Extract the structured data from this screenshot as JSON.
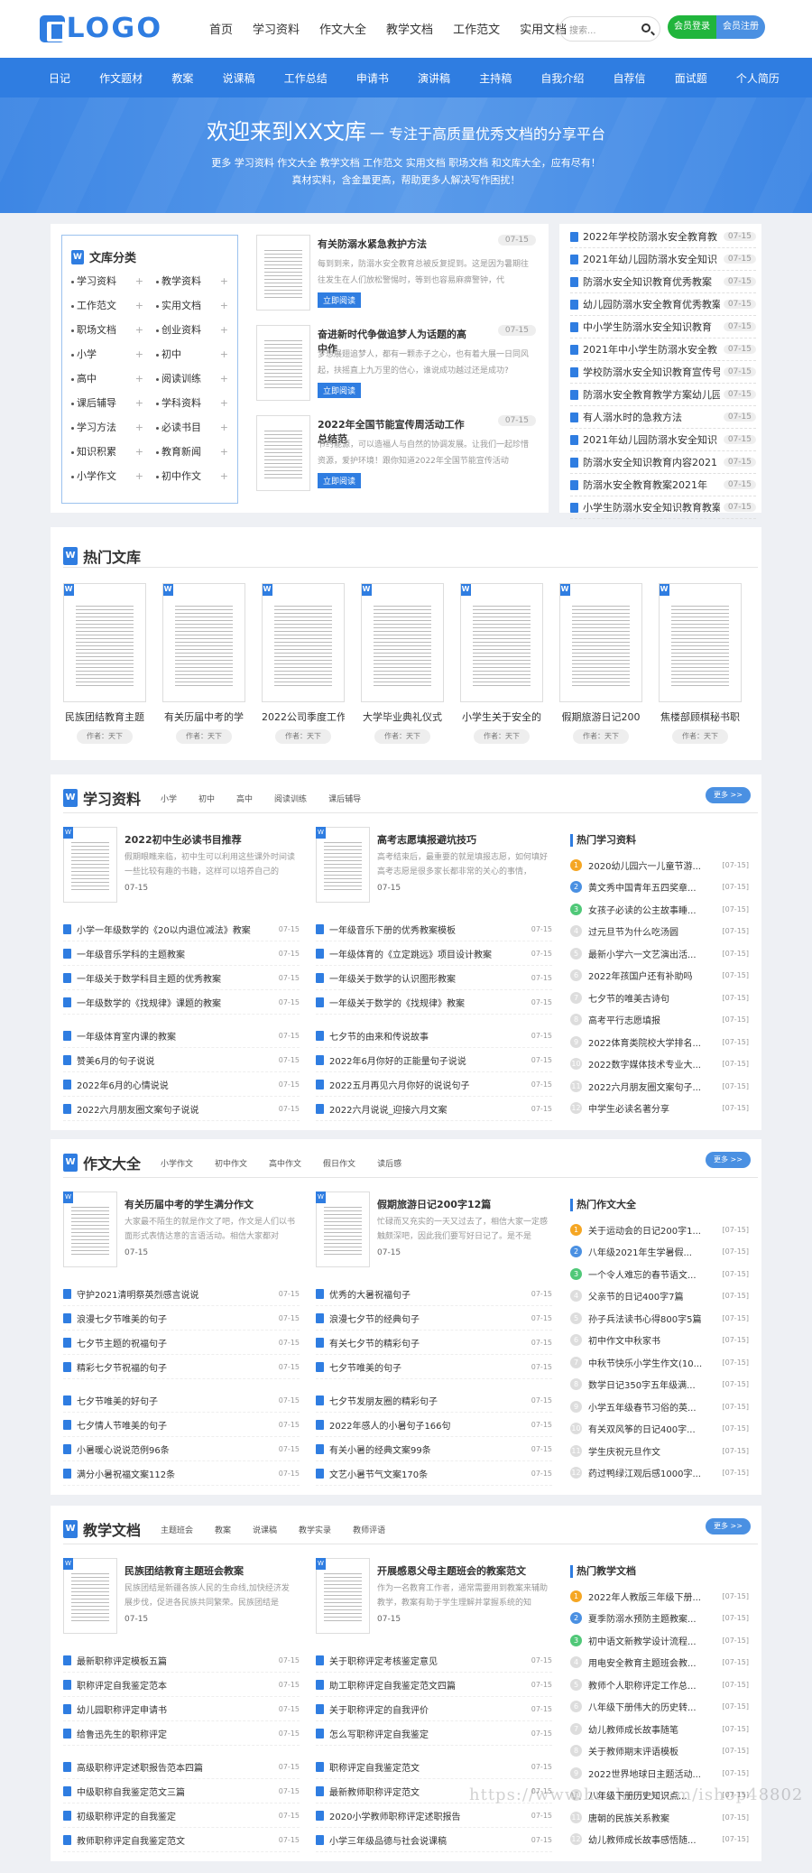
{
  "header": {
    "logo_text": "LOGO",
    "nav": [
      "首页",
      "学习资料",
      "作文大全",
      "教学文档",
      "工作范文",
      "实用文档"
    ],
    "search_placeholder": "搜索...",
    "login": "会员登录",
    "register": "会员注册"
  },
  "catbar": [
    "日记",
    "作文题材",
    "教案",
    "说课稿",
    "工作总结",
    "申请书",
    "演讲稿",
    "主持稿",
    "自我介绍",
    "自荐信",
    "面试题",
    "个人简历"
  ],
  "banner": {
    "title": "欢迎来到XX文库",
    "subtitle": "一 专注于高质量优秀文档的分享平台",
    "line1": "更多 学习资料 作文大全 教学文档 工作范文 实用文档 职场文档 和文库大全，应有尽有！",
    "line2": "真材实料，含金量更高，帮助更多人解决写作困扰！"
  },
  "categories": {
    "title": "文库分类",
    "items": [
      "学习资料",
      "教学资料",
      "工作范文",
      "实用文档",
      "职场文档",
      "创业资料",
      "小学",
      "初中",
      "高中",
      "阅读训练",
      "课后辅导",
      "学科资料",
      "学习方法",
      "必读书目",
      "知识积累",
      "教育新闻",
      "小学作文",
      "初中作文"
    ]
  },
  "featured": [
    {
      "title": "有关防溺水紧急救护方法",
      "date": "07-15",
      "desc": "每到到来，防溺水安全教育总被反复提到。这是因为暑期往往发生在人们放松警惕时，等到也容易麻痹警钟，代",
      "button": "立即阅读"
    },
    {
      "title": "奋进新时代争做追梦人为话题的高中作",
      "date": "07-15",
      "desc": "梦想展翅追梦人，都有一颗赤子之心，也有着大展一日同风起，扶摇直上九万里的信心，谁说成功越过还是成功?",
      "button": "立即阅读"
    },
    {
      "title": "2022年全国节能宣传周活动工作总结范",
      "date": "07-15",
      "desc": "节约能源，可以造福人与自然的协调发展。让我们一起珍惜资源，爱护环境！跟你知道2022年全国节能宣传活动",
      "button": "立即阅读"
    }
  ],
  "right_list": [
    {
      "title": "2022年学校防溺水安全教育教",
      "date": "07-15"
    },
    {
      "title": "2021年幼儿园防溺水安全知识",
      "date": "07-15"
    },
    {
      "title": "防溺水安全知识教育优秀教案",
      "date": "07-15"
    },
    {
      "title": "幼儿园防溺水安全教育优秀教案",
      "date": "07-15"
    },
    {
      "title": "中小学生防溺水安全知识教育",
      "date": "07-15"
    },
    {
      "title": "2021年中小学生防溺水安全教",
      "date": "07-15"
    },
    {
      "title": "学校防溺水安全知识教育宣传号",
      "date": "07-15"
    },
    {
      "title": "防溺水安全教育教学方案幼儿园",
      "date": "07-15"
    },
    {
      "title": "有人溺水时的急救方法",
      "date": "07-15"
    },
    {
      "title": "2021年幼儿园防溺水安全知识",
      "date": "07-15"
    },
    {
      "title": "防溺水安全知识教育内容2021",
      "date": "07-15"
    },
    {
      "title": "防溺水安全教育教案2021年",
      "date": "07-15"
    },
    {
      "title": "小学生防溺水安全知识教育教案",
      "date": "07-15"
    }
  ],
  "hot_library": {
    "title": "热门文库",
    "items": [
      {
        "title": "民族团结教育主题",
        "author": "作者：天下"
      },
      {
        "title": "有关历届中考的学",
        "author": "作者：天下"
      },
      {
        "title": "2022公司季度工作",
        "author": "作者：天下"
      },
      {
        "title": "大学毕业典礼仪式",
        "author": "作者：天下"
      },
      {
        "title": "小学生关于安全的",
        "author": "作者：天下"
      },
      {
        "title": "假期旅游日记200",
        "author": "作者：天下"
      },
      {
        "title": "焦楼部顾棋秘书职",
        "author": "作者：天下"
      }
    ]
  },
  "sections": [
    {
      "title": "学习资料",
      "tabs": [
        "小学",
        "初中",
        "高中",
        "阅读训练",
        "课后辅导"
      ],
      "more": "更多 >>",
      "leads": [
        {
          "title": "2022初中生必读书目推荐",
          "desc": "假期眼瞧来临，初中生可以利用这些课外时间读一些比较有趣的书籍，这样可以培养自己的",
          "date": "07-15"
        },
        {
          "title": "高考志愿填报避坑技巧",
          "desc": "高考结束后，最重要的就是填报志愿，如何填好高考志愿是很多家长都非常的关心的事情，",
          "date": "07-15"
        }
      ],
      "col1": [
        {
          "title": "小学一年级数学的《20以内退位减法》教案",
          "date": "07-15"
        },
        {
          "title": "一年级音乐学科的主题教案",
          "date": "07-15"
        },
        {
          "title": "一年级关于数学科目主题的优秀教案",
          "date": "07-15"
        },
        {
          "title": "一年级数学的《找规律》课题的教案",
          "date": "07-15"
        },
        {
          "title": "一年级体育室内课的教案",
          "date": "07-15"
        },
        {
          "title": "赞美6月的句子说说",
          "date": "07-15"
        },
        {
          "title": "2022年6月的心情说说",
          "date": "07-15"
        },
        {
          "title": "2022六月朋友圈文案句子说说",
          "date": "07-15"
        }
      ],
      "col2": [
        {
          "title": "一年级音乐下册的优秀教案模板",
          "date": "07-15"
        },
        {
          "title": "一年级体育的《立定跳远》项目设计教案",
          "date": "07-15"
        },
        {
          "title": "一年级关于数学的认识图形教案",
          "date": "07-15"
        },
        {
          "title": "一年级关于数学的《找规律》教案",
          "date": "07-15"
        },
        {
          "title": "七夕节的由来和传说故事",
          "date": "07-15"
        },
        {
          "title": "2022年6月你好的正能量句子说说",
          "date": "07-15"
        },
        {
          "title": "2022五月再见六月你好的说说句子",
          "date": "07-15"
        },
        {
          "title": "2022六月说说_迎接六月文案",
          "date": "07-15"
        }
      ],
      "hot_title": "热门学习资料",
      "hot": [
        {
          "title": "2020幼儿园六一儿童节游...",
          "date": "[07-15]"
        },
        {
          "title": "黄文秀中国青年五四奖章...",
          "date": "[07-15]"
        },
        {
          "title": "女孩子必读的公主故事睡...",
          "date": "[07-15]"
        },
        {
          "title": "过元旦节为什么吃汤圆",
          "date": "[07-15]"
        },
        {
          "title": "最新小学六一文艺演出活...",
          "date": "[07-15]"
        },
        {
          "title": "2022年孩国户还有补助吗",
          "date": "[07-15]"
        },
        {
          "title": "七夕节的唯美古诗句",
          "date": "[07-15]"
        },
        {
          "title": "高考平行志愿填报",
          "date": "[07-15]"
        },
        {
          "title": "2022体育类院校大学排名...",
          "date": "[07-15]"
        },
        {
          "title": "2022数字媒体技术专业大...",
          "date": "[07-15]"
        },
        {
          "title": "2022六月朋友圈文案句子...",
          "date": "[07-15]"
        },
        {
          "title": "中学生必读名著分享",
          "date": "[07-15]"
        }
      ]
    },
    {
      "title": "作文大全",
      "tabs": [
        "小学作文",
        "初中作文",
        "高中作文",
        "假日作文",
        "读后感"
      ],
      "more": "更多 >>",
      "leads": [
        {
          "title": "有关历届中考的学生满分作文",
          "desc": "大家最不陌生的就是作文了吧，作文是人们以书面形式表情达意的言语活动。相信大家都对",
          "date": "07-15"
        },
        {
          "title": "假期旅游日记200字12篇",
          "desc": "忙碌而又充实的一天又过去了，相信大家一定感触颇深吧，因此我们要写好日记了。是不是",
          "date": "07-15"
        }
      ],
      "col1": [
        {
          "title": "守护2021清明祭英烈感言说说",
          "date": "07-15"
        },
        {
          "title": "浪漫七夕节唯美的句子",
          "date": "07-15"
        },
        {
          "title": "七夕节主题的祝福句子",
          "date": "07-15"
        },
        {
          "title": "精彩七夕节祝福的句子",
          "date": "07-15"
        },
        {
          "title": "七夕节唯美的好句子",
          "date": "07-15"
        },
        {
          "title": "七夕情人节唯美的句子",
          "date": "07-15"
        },
        {
          "title": "小暑暖心说说范例96条",
          "date": "07-15"
        },
        {
          "title": "满分小暑祝福文案112条",
          "date": "07-15"
        }
      ],
      "col2": [
        {
          "title": "优秀的大暑祝福句子",
          "date": "07-15"
        },
        {
          "title": "浪漫七夕节的经典句子",
          "date": "07-15"
        },
        {
          "title": "有关七夕节的精彩句子",
          "date": "07-15"
        },
        {
          "title": "七夕节唯美的句子",
          "date": "07-15"
        },
        {
          "title": "七夕节发朋友圈的精彩句子",
          "date": "07-15"
        },
        {
          "title": "2022年感人的小暑句子166句",
          "date": "07-15"
        },
        {
          "title": "有关小暑的经典文案99条",
          "date": "07-15"
        },
        {
          "title": "文艺小暑节气文案170条",
          "date": "07-15"
        }
      ],
      "hot_title": "热门作文大全",
      "hot": [
        {
          "title": "关于运动会的日记200字1...",
          "date": "[07-15]"
        },
        {
          "title": "八年级2021年生学暑假...",
          "date": "[07-15]"
        },
        {
          "title": "一个令人难忘的春节语文...",
          "date": "[07-15]"
        },
        {
          "title": "父亲节的日记400字7篇",
          "date": "[07-15]"
        },
        {
          "title": "孙子兵法读书心得800字5篇",
          "date": "[07-15]"
        },
        {
          "title": "初中作文中秋家书",
          "date": "[07-15]"
        },
        {
          "title": "中秋节快乐小学生作文(10...",
          "date": "[07-15]"
        },
        {
          "title": "数学日记350字五年级满...",
          "date": "[07-15]"
        },
        {
          "title": "小学五年级春节习俗的英...",
          "date": "[07-15]"
        },
        {
          "title": "有关双风筝的日记400字...",
          "date": "[07-15]"
        },
        {
          "title": "学生庆祝元旦作文",
          "date": "[07-15]"
        },
        {
          "title": "药过鸭绿江观后感1000字...",
          "date": "[07-15]"
        }
      ]
    },
    {
      "title": "教学文档",
      "tabs": [
        "主题班会",
        "教案",
        "说课稿",
        "教学实录",
        "教师评语"
      ],
      "more": "更多 >>",
      "leads": [
        {
          "title": "民族团结教育主题班会教案",
          "desc": "民族团结是新疆各族人民的生命线,加快经济发展步伐，促进各民族共同繁荣。民族团结是",
          "date": "07-15"
        },
        {
          "title": "开展感恩父母主题班会的教案范文",
          "desc": "作为一名教育工作者，通常需要用到教案来辅助教学，教案有助于学生理解并掌握系统的知",
          "date": "07-15"
        }
      ],
      "col1": [
        {
          "title": "最新职称评定模板五篇",
          "date": "07-15"
        },
        {
          "title": "职称评定自我鉴定范本",
          "date": "07-15"
        },
        {
          "title": "幼儿园职称评定申请书",
          "date": "07-15"
        },
        {
          "title": "给鲁迅先生的职称评定",
          "date": "07-15"
        },
        {
          "title": "高级职称评定述职报告范本四篇",
          "date": "07-15"
        },
        {
          "title": "中级职称自我鉴定范文三篇",
          "date": "07-15"
        },
        {
          "title": "初级职称评定的自我鉴定",
          "date": "07-15"
        },
        {
          "title": "教师职称评定自我鉴定范文",
          "date": "07-15"
        }
      ],
      "col2": [
        {
          "title": "关于职称评定考核鉴定意见",
          "date": "07-15"
        },
        {
          "title": "助工职称评定自我鉴定范文四篇",
          "date": "07-15"
        },
        {
          "title": "关于职称评定的自我评价",
          "date": "07-15"
        },
        {
          "title": "怎么写职称评定自我鉴定",
          "date": "07-15"
        },
        {
          "title": "职称评定自我鉴定范文",
          "date": "07-15"
        },
        {
          "title": "最新教师职称评定范文",
          "date": "07-15"
        },
        {
          "title": "2020小学教师职称评定述职报告",
          "date": "07-15"
        },
        {
          "title": "小学三年级品德与社会说课稿",
          "date": "07-15"
        }
      ],
      "hot_title": "热门教学文档",
      "hot": [
        {
          "title": "2022年人教版三年级下册...",
          "date": "[07-15]"
        },
        {
          "title": "夏季防溺水预防主题教案...",
          "date": "[07-15]"
        },
        {
          "title": "初中语文新教学设计流程...",
          "date": "[07-15]"
        },
        {
          "title": "用电安全教育主题班会教...",
          "date": "[07-15]"
        },
        {
          "title": "教师个人职称评定工作总...",
          "date": "[07-15]"
        },
        {
          "title": "八年级下册伟大的历史转...",
          "date": "[07-15]"
        },
        {
          "title": "幼儿教师成长故事随笔",
          "date": "[07-15]"
        },
        {
          "title": "关于教师期末评语模板",
          "date": "[07-15]"
        },
        {
          "title": "2022世界地球日主题活动...",
          "date": "[07-15]"
        },
        {
          "title": "八年级下册历史知识点...",
          "date": "[07-15]"
        },
        {
          "title": "唐朝的民族关系教案",
          "date": "[07-15]"
        },
        {
          "title": "幼儿教师成长故事感悟随...",
          "date": "[07-15]"
        }
      ]
    }
  ],
  "watermark": "https://www.huzhan.com/ishop48802",
  "colors": {
    "primary": "#2f7de1",
    "green": "#20b53c",
    "hot_orange": "#f5a623",
    "hot_blue": "#4a90e2",
    "hot_green": "#50c878"
  }
}
